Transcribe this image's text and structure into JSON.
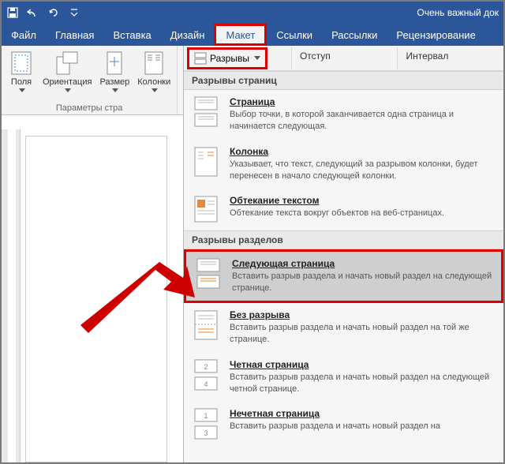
{
  "titlebar": {
    "doc_title": "Очень важный док"
  },
  "tabs": {
    "file": "Файл",
    "home": "Главная",
    "insert": "Вставка",
    "design": "Дизайн",
    "layout": "Макет",
    "references": "Ссылки",
    "mailings": "Рассылки",
    "review": "Рецензирование"
  },
  "ribbon": {
    "margins": "Поля",
    "orientation": "Ориентация",
    "size": "Размер",
    "columns": "Колонки",
    "group_page_setup": "Параметры стра",
    "breaks": "Разрывы",
    "indent": "Отступ",
    "spacing": "Интервал"
  },
  "gallery": {
    "section_page_breaks": "Разрывы страниц",
    "page": {
      "title": "Страница",
      "desc": "Выбор точки, в которой заканчивается одна страница и начинается следующая."
    },
    "column": {
      "title": "Колонка",
      "desc": "Указывает, что текст, следующий за разрывом колонки, будет перенесен в начало следующей колонки."
    },
    "text_wrapping": {
      "title": "Обтекание текстом",
      "desc": "Обтекание текста вокруг объектов на веб-страницах."
    },
    "section_section_breaks": "Разрывы разделов",
    "next_page": {
      "title": "Следующая страница",
      "desc": "Вставить разрыв раздела и начать новый раздел на следующей странице."
    },
    "continuous": {
      "title": "Без разрыва",
      "desc": "Вставить разрыв раздела и начать новый раздел на той же странице."
    },
    "even_page": {
      "title": "Четная страница",
      "desc": "Вставить разрыв раздела и начать новый раздел на следующей четной странице."
    },
    "odd_page": {
      "title": "Нечетная страница",
      "desc": "Вставить разрыв раздела и начать новый раздел на"
    }
  }
}
